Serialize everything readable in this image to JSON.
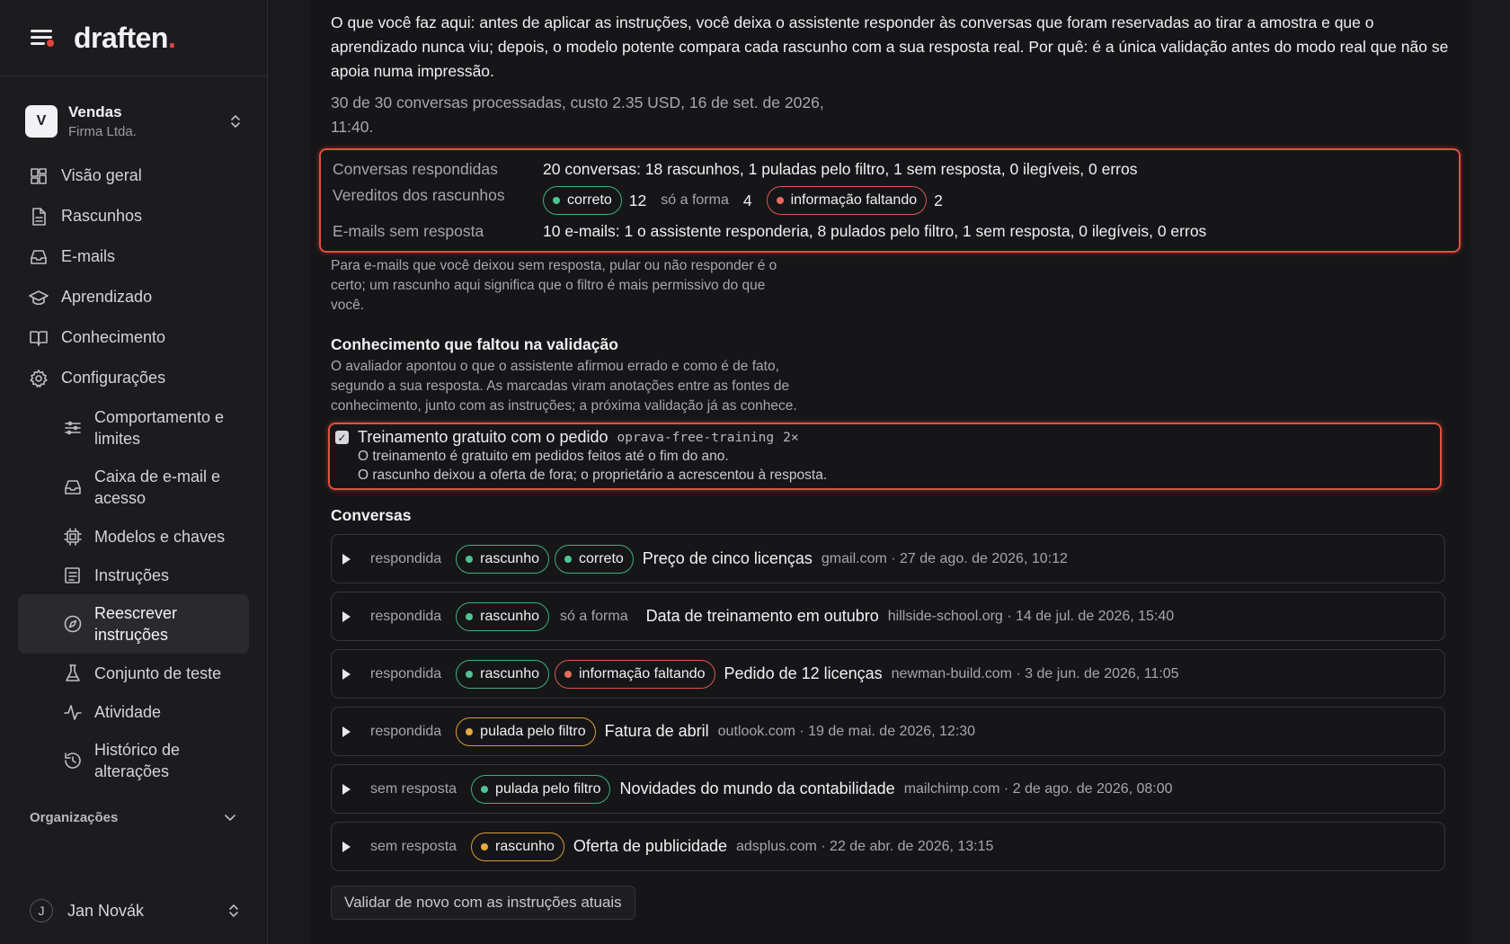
{
  "app": {
    "logo_text": "draften",
    "logo_dot": "."
  },
  "workspace": {
    "initial": "V",
    "name": "Vendas",
    "company": "Firma Ltda."
  },
  "nav": [
    {
      "label": "Visão geral",
      "icon": "dashboard-icon"
    },
    {
      "label": "Rascunhos",
      "icon": "document-icon"
    },
    {
      "label": "E-mails",
      "icon": "inbox-icon"
    },
    {
      "label": "Aprendizado",
      "icon": "graduation-cap-icon"
    },
    {
      "label": "Conhecimento",
      "icon": "book-icon"
    },
    {
      "label": "Configurações",
      "icon": "gear-icon"
    }
  ],
  "subnav": [
    {
      "label": "Comportamento e limites",
      "icon": "sliders-icon"
    },
    {
      "label": "Caixa de e-mail e acesso",
      "icon": "inbox-icon"
    },
    {
      "label": "Modelos e chaves",
      "icon": "chip-icon"
    },
    {
      "label": "Instruções",
      "icon": "list-icon"
    },
    {
      "label": "Reescrever instruções",
      "icon": "compass-icon",
      "active": true
    },
    {
      "label": "Conjunto de teste",
      "icon": "flask-icon"
    },
    {
      "label": "Atividade",
      "icon": "activity-icon"
    },
    {
      "label": "Histórico de alterações",
      "icon": "history-icon"
    }
  ],
  "orgs_label": "Organizações",
  "user": {
    "initial": "J",
    "name": "Jan Novák"
  },
  "main": {
    "intro": "O que você faz aqui: antes de aplicar as instruções, você deixa o assistente responder às conversas que foram reservadas ao tirar a amostra e que o aprendizado nunca viu; depois, o modelo potente compara cada rascunho com a sua resposta real. Por quê: é a única validação antes do modo real que não se apoia numa impressão.",
    "meta": "30 de 30 conversas processadas, custo 2.35 USD, 16 de set. de 2026, 11:40.",
    "summary": {
      "answered_label": "Conversas respondidas",
      "answered_value": "20 conversas: 18 rascunhos, 1 puladas pelo filtro, 1 sem resposta, 0 ilegíveis, 0 erros",
      "verdicts_label": "Vereditos dos rascunhos",
      "verdict_correct": "correto",
      "verdict_correct_count": "12",
      "verdict_form": "só a forma",
      "verdict_form_count": "4",
      "verdict_missing": "informação faltando",
      "verdict_missing_count": "2",
      "unanswered_label": "E-mails sem resposta",
      "unanswered_value": "10 e-mails: 1 o assistente responderia, 8 pulados pelo filtro, 1 sem resposta, 0 ilegíveis, 0 erros"
    },
    "note": "Para e-mails que você deixou sem resposta, pular ou não responder é o certo; um rascunho aqui significa que o filtro é mais permissivo do que você.",
    "gap_section": {
      "title": "Conhecimento que faltou na validação",
      "desc": "O avaliador apontou o que o assistente afirmou errado e como é de fato, segundo a sua resposta. As marcadas viram anotações entre as fontes de conhecimento, junto com as instruções; a próxima validação já as conhece.",
      "item": {
        "title": "Treinamento gratuito com o pedido",
        "code": "oprava-free-training",
        "count": "2×",
        "line1": "O treinamento é gratuito em pedidos feitos até o fim do ano.",
        "line2": "O rascunho deixou a oferta de fora; o proprietário a acrescentou à resposta."
      }
    },
    "conversations_title": "Conversas",
    "conversations": [
      {
        "state": "respondida",
        "badges": [
          {
            "text": "rascunho",
            "color": "green"
          },
          {
            "text": "correto",
            "color": "green"
          }
        ],
        "subject": "Preço de cinco licenças",
        "from": "gmail.com · 27 de ago. de 2026, 10:12"
      },
      {
        "state": "respondida",
        "badges": [
          {
            "text": "rascunho",
            "color": "green"
          },
          {
            "text": "só a forma",
            "color": "plain"
          }
        ],
        "subject": "Data de treinamento em outubro",
        "from": "hillside-school.org · 14 de jul. de 2026, 15:40"
      },
      {
        "state": "respondida",
        "badges": [
          {
            "text": "rascunho",
            "color": "green"
          },
          {
            "text": "informação faltando",
            "color": "red"
          }
        ],
        "subject": "Pedido de 12 licenças",
        "from": "newman-build.com · 3 de jun. de 2026, 11:05"
      },
      {
        "state": "respondida",
        "badges": [
          {
            "text": "pulada pelo filtro",
            "color": "orange"
          }
        ],
        "subject": "Fatura de abril",
        "from": "outlook.com · 19 de mai. de 2026, 12:30"
      },
      {
        "state": "sem resposta",
        "badges": [
          {
            "text": "pulada pelo filtro",
            "color": "green"
          }
        ],
        "subject": "Novidades do mundo da contabilidade",
        "from": "mailchimp.com · 2 de ago. de 2026, 08:00"
      },
      {
        "state": "sem resposta",
        "badges": [
          {
            "text": "rascunho",
            "color": "orange"
          }
        ],
        "subject": "Oferta de publicidade",
        "from": "adsplus.com · 22 de abr. de 2026, 13:15"
      }
    ],
    "revalidate_button": "Validar de novo com as instruções atuais"
  }
}
